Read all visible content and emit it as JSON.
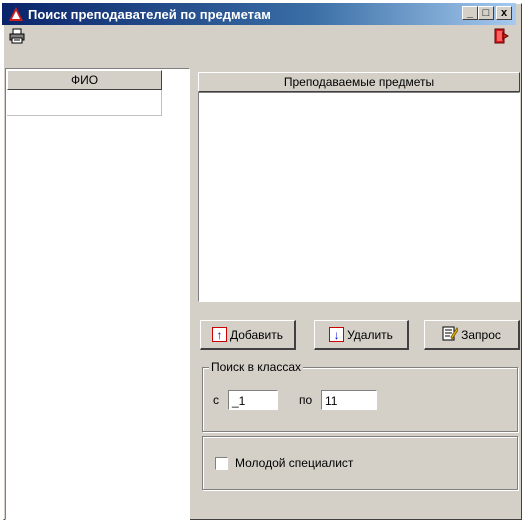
{
  "window": {
    "title": "Поиск преподавателей по предметам",
    "minimize": "_",
    "maximize": "□",
    "close": "x"
  },
  "toolbar": {
    "print_icon": "printer-icon",
    "exit_icon": "exit-door-icon"
  },
  "teachers_grid": {
    "column_header": "ФИО",
    "rows": [
      ""
    ]
  },
  "subjects": {
    "header": "Преподаваемые предметы",
    "items": []
  },
  "buttons": {
    "add": "Добавить",
    "remove": "Удалить",
    "query": "Запрос"
  },
  "class_search": {
    "caption": "Поиск в классах",
    "from_label": "с",
    "from_value": "_1",
    "to_label": "по",
    "to_value": "11"
  },
  "young_specialist": {
    "label": "Молодой специалист",
    "checked": false
  },
  "colors": {
    "title_bar_start": "#0a246a",
    "title_bar_end": "#a6caf0",
    "face": "#d4d0c8"
  }
}
